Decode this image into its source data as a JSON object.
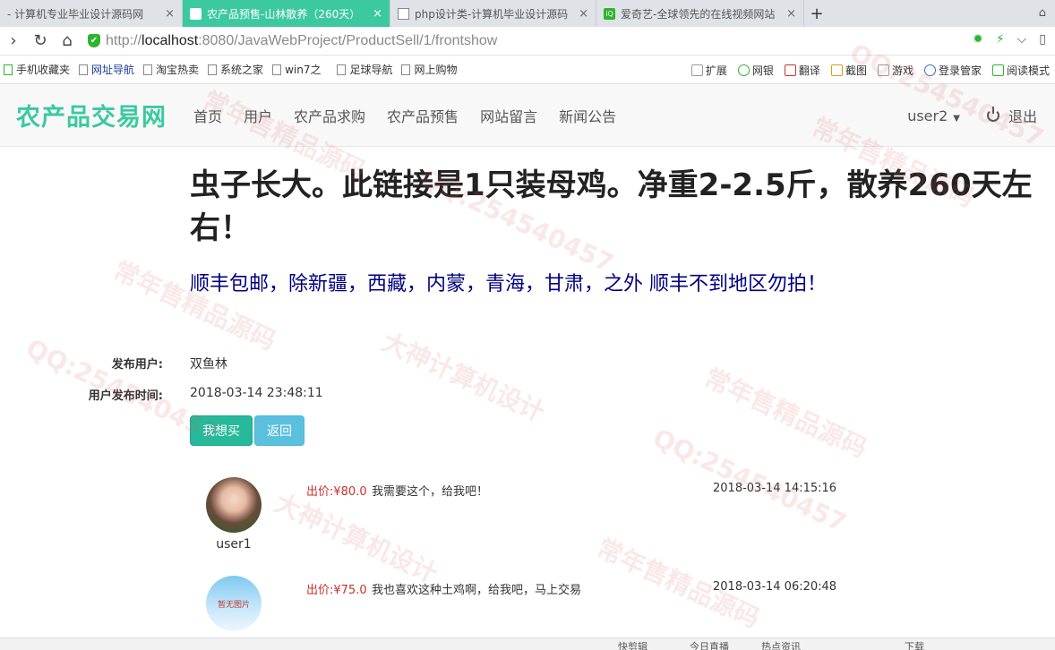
{
  "browser": {
    "tabs": [
      {
        "label": "- 计算机专业毕业设计源码网",
        "icon": "none",
        "active": false
      },
      {
        "label": "农产品预售-山林散养（260天）",
        "icon": "white",
        "active": true
      },
      {
        "label": "php设计类-计算机毕业设计源码",
        "icon": "doc",
        "active": false
      },
      {
        "label": "爱奇艺-全球领先的在线视频网站",
        "icon": "green",
        "active": false
      }
    ],
    "tab_close": "×",
    "new_tab": "+",
    "url_scheme": "http://",
    "url_host": "localhost",
    "url_path": ":8080/JavaWebProject/ProductSell/1/frontshow",
    "bookmarks": [
      {
        "label": "手机收藏夹",
        "style": "green"
      },
      {
        "label": "网址导航",
        "style": "blue"
      },
      {
        "label": "淘宝热卖",
        "style": "doc"
      },
      {
        "label": "系统之家",
        "style": "doc"
      },
      {
        "label": "win7之",
        "style": "doc"
      },
      {
        "label": "足球导航",
        "style": "doc"
      },
      {
        "label": "网上购物",
        "style": "doc"
      }
    ],
    "toolbar_items": [
      "扩展",
      "网银",
      "翻译",
      "截图",
      "游戏",
      "登录管家",
      "阅读模式"
    ]
  },
  "site": {
    "brand": "农产品交易网",
    "menu": [
      "首页",
      "用户",
      "农产品求购",
      "农产品预售",
      "网站留言",
      "新闻公告"
    ],
    "current_user": "user2",
    "logout": "退出"
  },
  "product": {
    "title": "虫子长大。此链接是1只装母鸡。净重2-2.5斤，散养260天左右！",
    "subtitle": "顺丰包邮，除新疆，西藏，内蒙，青海，甘肃，之外 顺丰不到地区勿拍！",
    "publisher_label": "发布用户:",
    "publisher": "双鱼林",
    "publish_time_label": "用户发布时间:",
    "publish_time": "2018-03-14 23:48:11",
    "buy_button": "我想买",
    "back_button": "返回"
  },
  "bids": [
    {
      "user": "user1",
      "price": "出价:¥80.0",
      "message": "我需要这个，给我吧！",
      "time": "2018-03-14 14:15:16",
      "avatar": "photo"
    },
    {
      "user": "",
      "price": "出价:¥75.0",
      "message": "我也喜欢这种土鸡啊，给我吧，马上交易",
      "time": "2018-03-14 06:20:48",
      "avatar": "placeholder",
      "avatar_text": "暂无图片"
    }
  ],
  "statusbar": [
    "快剪辑",
    "今日直播",
    "热点资讯",
    "下载"
  ],
  "watermark": [
    "常年售精品源码",
    "大神计算机设计",
    "QQ:254540457"
  ],
  "colors": {
    "brand": "#3cc9a0",
    "buy": "#26b99a",
    "back": "#5bc0de",
    "subtitle": "#000080",
    "price": "#c9302c"
  }
}
